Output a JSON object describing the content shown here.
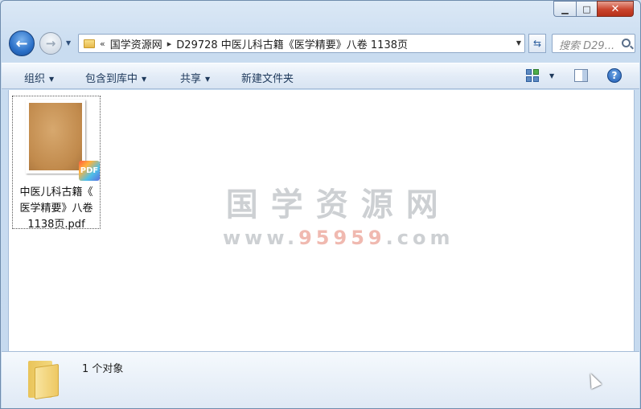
{
  "window": {
    "caption": {
      "minimize": "▁",
      "maximize": "□",
      "close": "✕"
    }
  },
  "nav": {
    "back_icon": "←",
    "forward_icon": "→",
    "dropdown_icon": "▼"
  },
  "address": {
    "chevrons": "«",
    "crumbs": [
      "国学资源网",
      "D29728 中医儿科古籍《医学精要》八卷 1138页"
    ],
    "separator": "▸",
    "dropdown_icon": "▼",
    "refresh_icon": "⇆"
  },
  "search": {
    "placeholder": "搜索 D29..."
  },
  "toolbar": {
    "organize": "组织",
    "include_in_library": "包含到库中",
    "share": "共享",
    "new_folder": "新建文件夹",
    "arrow": "▼",
    "help": "?"
  },
  "files": [
    {
      "name": "中医儿科古籍《医学精要》八卷1138页.pdf",
      "name_lines": [
        "中医儿科古籍《",
        "医学精要》八卷",
        "1138页.pdf"
      ],
      "badge": "PDF"
    }
  ],
  "watermark": {
    "line1": "国学资源网",
    "line2_prefix": "www.",
    "line2_digits": "95959",
    "line2_suffix": ".com"
  },
  "status": {
    "count_text": "1 个对象"
  },
  "colors": {
    "accent": "#1e395b",
    "close": "#c9442d",
    "folder": "#eec863"
  }
}
